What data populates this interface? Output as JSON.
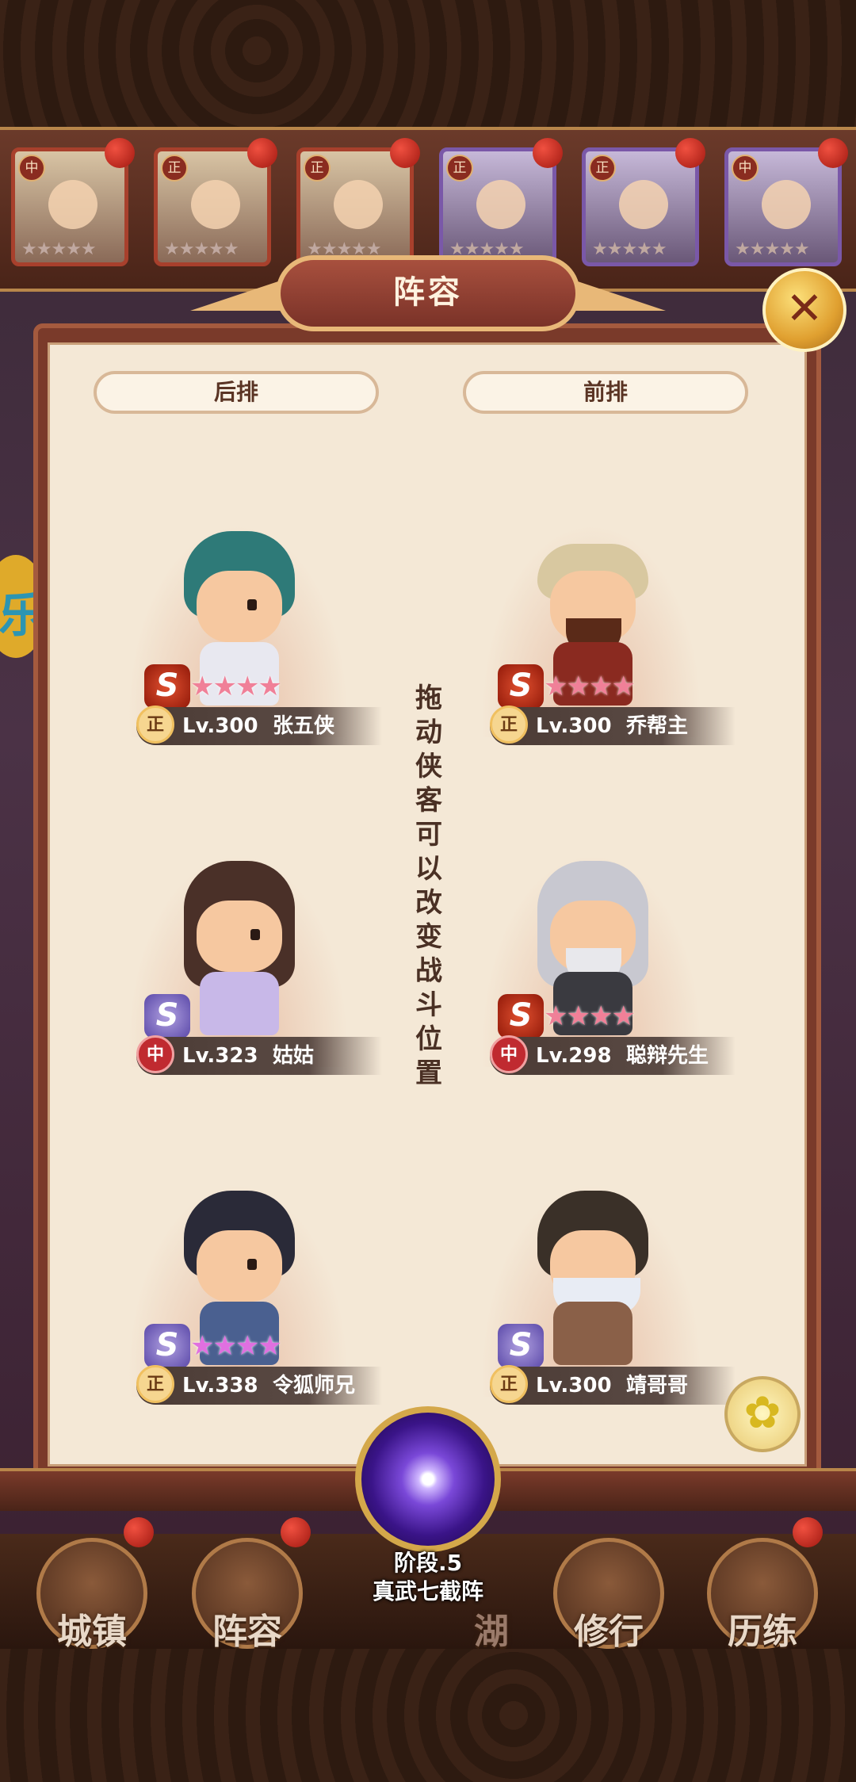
{
  "title": "阵容",
  "close_symbol": "✕",
  "hero_bar": [
    {
      "tag": "中",
      "stars": "★★★★★"
    },
    {
      "tag": "正",
      "stars": "★★★★★"
    },
    {
      "tag": "正",
      "stars": "★★★★★"
    },
    {
      "tag": "正",
      "stars": "★★★★★"
    },
    {
      "tag": "正",
      "stars": "★★★★★"
    },
    {
      "tag": "中",
      "stars": "★★★★★"
    }
  ],
  "left_label": "后排",
  "right_label": "前排",
  "hint": "拖动侠客可以改变战斗位置",
  "slots": [
    {
      "faction": "正",
      "level": "Lv.300",
      "name": "张五侠",
      "stars": "★★★★"
    },
    {
      "faction": "正",
      "level": "Lv.300",
      "name": "乔帮主",
      "stars": "★★★★"
    },
    {
      "faction": "中",
      "level": "Lv.323",
      "name": "姑姑",
      "stars": ""
    },
    {
      "faction": "中",
      "level": "Lv.298",
      "name": "聪辩先生",
      "stars": "★★★★"
    },
    {
      "faction": "正",
      "level": "Lv.338",
      "name": "令狐师兄",
      "stars": "★★★★"
    },
    {
      "faction": "正",
      "level": "Lv.300",
      "name": "靖哥哥",
      "stars": ""
    }
  ],
  "stage": {
    "label": "阶段.5",
    "name": "真武七截阵"
  },
  "nav": [
    "城镇",
    "阵容",
    "湖",
    "修行",
    "历练"
  ],
  "colors": {
    "panel": "#7a3a2a",
    "parchment": "#f4e8d6",
    "accent_gold": "#e8b878"
  }
}
